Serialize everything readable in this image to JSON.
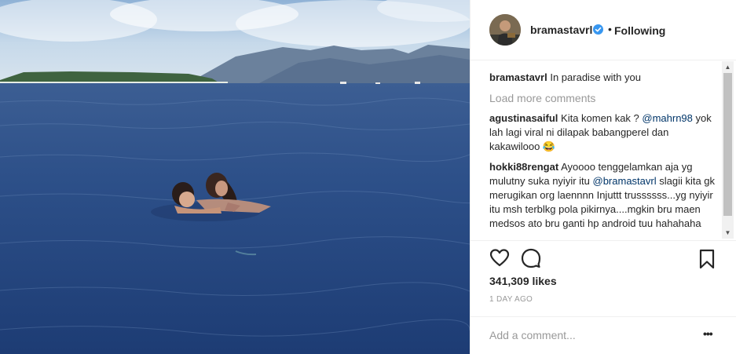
{
  "post": {
    "username": "bramastavrl",
    "separator": "•",
    "follow_status": "Following",
    "caption_user": "bramastavrl",
    "caption_text": "In paradise with you",
    "load_more": "Load more comments",
    "comments": [
      {
        "user": "agustinasaiful",
        "text_before": "Kita komen kak ? ",
        "mention": "@mahrn98",
        "text_after": " yok lah lagi viral ni dilapak babangperel dan kakawilooo 😂"
      },
      {
        "user": "hokki88rengat",
        "text_before": "Ayoooo tenggelamkan aja yg mulutny suka nyiyir itu ",
        "mention": "@bramastavrl",
        "text_after": " slagii kita gk merugikan org laennnn Injuttt trussssss...yg nyiyir itu msh terblkg pola pikirnya....mgkin bru maen medsos ato bru ganti hp android tuu hahahaha"
      }
    ],
    "likes": "341,309 likes",
    "time_ago": "1 DAY AGO",
    "add_comment_placeholder": "Add a comment...",
    "more_options": "•••"
  },
  "scrollbar": {
    "up_arrow": "▲",
    "down_arrow": "▼"
  },
  "icons": {
    "avatar": "avatar",
    "verified": "verified-badge-icon",
    "like": "heart-icon",
    "comment": "comment-bubble-icon",
    "save": "bookmark-icon"
  },
  "colors": {
    "verified_blue": "#3897f0",
    "mention": "#003569",
    "muted_text": "#999999",
    "sea_deep": "#22457e",
    "sky": "#c9dcec"
  }
}
